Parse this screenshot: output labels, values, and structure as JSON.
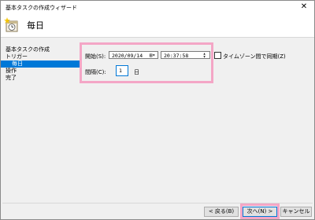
{
  "window": {
    "title": "基本タスクの作成ウィザード",
    "close_glyph": "✕"
  },
  "header": {
    "title": "毎日",
    "icon": "task-scheduler-icon"
  },
  "nav": {
    "items": [
      {
        "label": "基本タスクの作成"
      },
      {
        "label": "トリガー"
      },
      {
        "label": "毎日"
      },
      {
        "label": "操作"
      },
      {
        "label": "完了"
      }
    ]
  },
  "form": {
    "start_label": "開始(S):",
    "start_date": "2020/09/14",
    "start_time": "20:37:58",
    "timezone_sync_label": "タイムゾーン間で同期(Z)",
    "timezone_sync_checked": false,
    "interval_label": "間隔(C):",
    "interval_value": "1",
    "interval_unit": "日"
  },
  "buttons": {
    "back": "< 戻る(B)",
    "next": "次へ(N) >",
    "cancel": "キャンセル"
  },
  "colors": {
    "selection": "#0078d7",
    "highlight": "#f4a6c6"
  }
}
